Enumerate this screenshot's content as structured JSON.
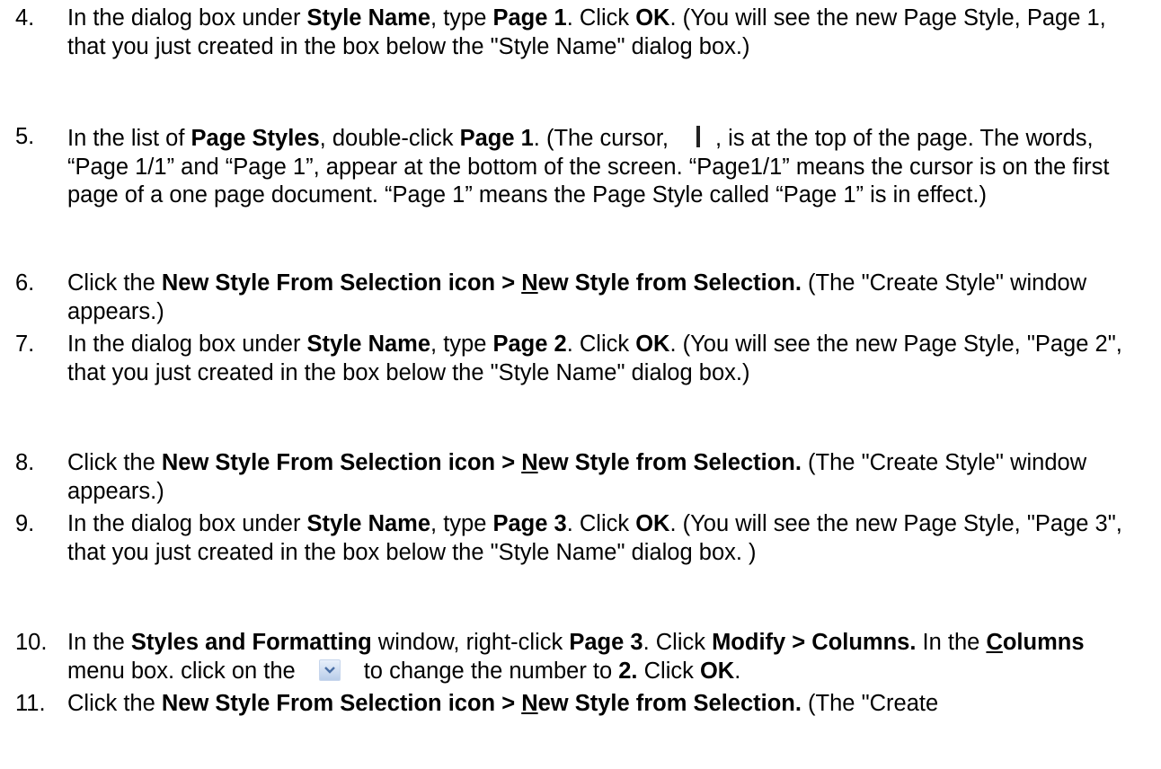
{
  "steps": [
    {
      "num": "4.",
      "a": "In the dialog box under ",
      "b1": "Style Name",
      "a2": ", type ",
      "b2": "Page 1",
      "a3": ".  Click ",
      "b3": "OK",
      "a4": ".  (You will see the new Page Style, Page 1, that you just created in the box below the \"Style Name\" dialog box.)"
    },
    {
      "num": "5.",
      "a": "In the list of ",
      "b1": "Page Styles",
      "a2": ", double-click ",
      "b2": "Page 1",
      "a3": ".  (The cursor,",
      "a4": ", is at the top of the page.  The words, “Page 1/1” and “Page 1”, appear at the bottom of the screen.  “Page1/1” means the cursor is on the first page of a one page document.  “Page 1” means the Page Style called “Page 1” is in effect.)"
    },
    {
      "num": "6.",
      "a": "Click the ",
      "b1": "New Style From Selection icon > ",
      "b1u": "N",
      "b1rest": "ew Style from Selection.",
      "a2": " (The \"Create Style\" window appears.)"
    },
    {
      "num": "7.",
      "a": "In the dialog box under ",
      "b1": "Style Name",
      "a2": ", type ",
      "b2": "Page 2",
      "a3": ".  Click ",
      "b3": "OK",
      "a4": ".  (You will see the new Page Style, \"Page 2\",  that you just created in the box below the \"Style Name\" dialog box.)"
    },
    {
      "num": "8.",
      "a": "Click the ",
      "b1": "New Style From Selection icon > ",
      "b1u": "N",
      "b1rest": "ew Style from Selection.",
      "a2": " (The \"Create Style\" window appears.)"
    },
    {
      "num": "9.",
      "a": "In the dialog box under ",
      "b1": "Style Name",
      "a2": ", type ",
      "b2": "Page 3",
      "a3": ".  Click ",
      "b3": "OK",
      "a4": ".  (You will see the new Page Style, \"Page 3\",  that you just created in the box below the \"Style Name\" dialog box. )"
    },
    {
      "num": "10.",
      "a": "In the ",
      "b1": "Styles and Formatting",
      "a2": " window, right-click ",
      "b2": "Page 3",
      "a3": ".  Click ",
      "b3": "Modify > Columns.",
      "a4": "  In the ",
      "b4u": "C",
      "b4rest": "olumns",
      "a5": " menu box. click on the",
      "a6": "to change the number to ",
      "b5": "2.",
      "a7": "  Click ",
      "b6": "OK",
      "a8": "."
    },
    {
      "num": "11.",
      "a": "Click the ",
      "b1": "New Style From Selection icon > ",
      "b1u": "N",
      "b1rest": "ew Style from Selection.",
      "a2": " (The \"Create"
    }
  ]
}
